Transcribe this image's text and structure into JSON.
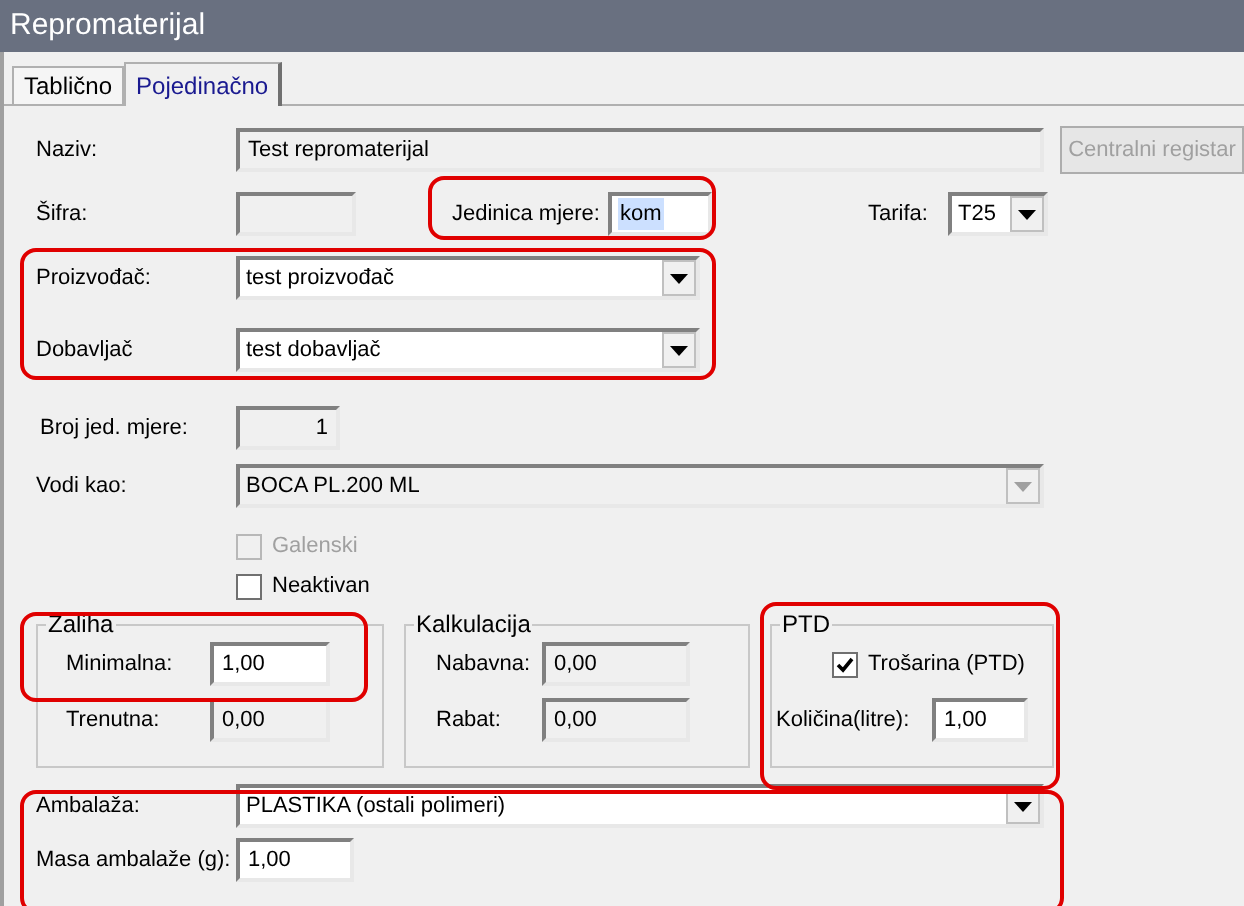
{
  "window": {
    "title": "Repromaterijal"
  },
  "tabs": [
    {
      "label": "Tablično",
      "selected": false
    },
    {
      "label": "Pojedinačno",
      "selected": true
    }
  ],
  "naziv": {
    "label": "Naziv:",
    "value": "Test repromaterijal",
    "disabled": true
  },
  "central_button": {
    "label": "Centralni registar",
    "disabled": true
  },
  "sifra": {
    "label": "Šifra:",
    "disabled": true
  },
  "jedinica_mjere": {
    "label": "Jedinica mjere:",
    "value": "kom",
    "selected": true
  },
  "tarifa": {
    "label": "Tarifa:",
    "value": "T25"
  },
  "proizvodac": {
    "label": "Proizvođač:",
    "value": "test proizvođač"
  },
  "dobavljac": {
    "label": "Dobavljač",
    "value": "test dobavljač"
  },
  "broj_jed_mjere": {
    "label": "Broj jed. mjere:",
    "value": "1",
    "disabled": true
  },
  "vodi_kao": {
    "label": "Vodi kao:",
    "value": "BOCA PL.200 ML",
    "disabled": true
  },
  "checkboxes": [
    {
      "label": "Galenski",
      "checked": false,
      "disabled": true
    },
    {
      "label": "Neaktivan",
      "checked": false,
      "disabled": false
    }
  ],
  "groups": [
    {
      "title": "Zaliha",
      "items": [
        {
          "kind": "field",
          "label": "Minimalna:",
          "value": "1,00",
          "disabled": false
        },
        {
          "kind": "field",
          "label": "Trenutna:",
          "value": "0,00",
          "disabled": true
        }
      ]
    },
    {
      "title": "Kalkulacija",
      "items": [
        {
          "kind": "field",
          "label": "Nabavna:",
          "value": "0,00",
          "disabled": true
        },
        {
          "kind": "field",
          "label": "Rabat:",
          "value": "0,00",
          "disabled": true
        }
      ]
    },
    {
      "title": "PTD",
      "items": [
        {
          "kind": "checkbox",
          "label": "Trošarina (PTD)",
          "checked": true
        },
        {
          "kind": "field",
          "label": "Količina(litre):",
          "value": "1,00",
          "disabled": false
        }
      ]
    }
  ],
  "ambalaza": {
    "label": "Ambalaža:",
    "value": "PLASTIKA (ostali polimeri)"
  },
  "masa_ambalaze": {
    "label": "Masa ambalaže (g):",
    "value": "1,00"
  }
}
